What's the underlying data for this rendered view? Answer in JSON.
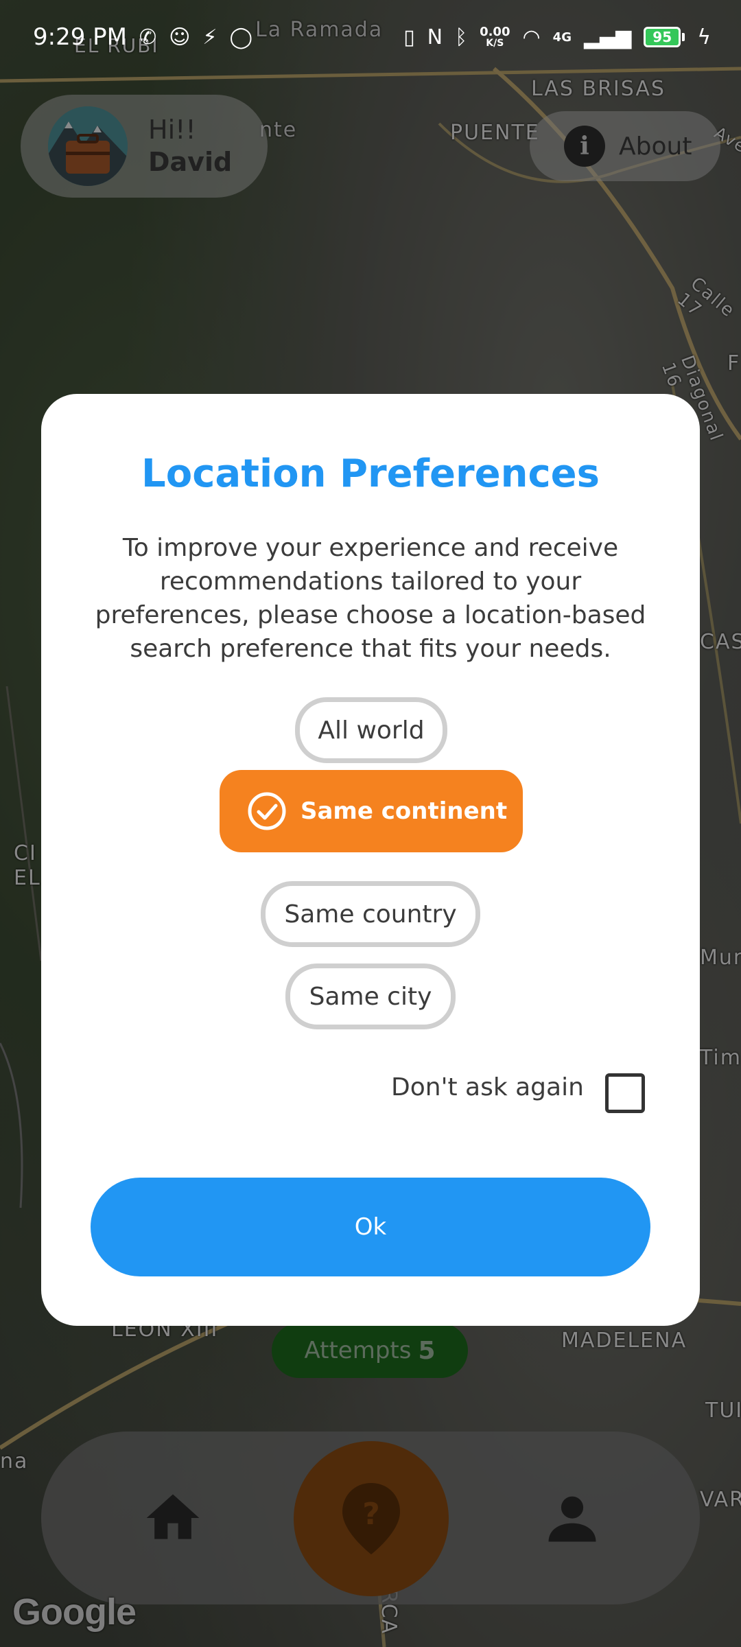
{
  "status_bar": {
    "time": "9:29 PM",
    "speed_value": "0.00",
    "speed_unit": "K/S",
    "network": "4G",
    "battery": "95"
  },
  "map": {
    "labels": [
      "La Ramada",
      "EL RUBI",
      "LAS BRISAS",
      "PUENTE",
      "Calle 17",
      "Diagonal 16",
      "LEON XIII",
      "MADELENA",
      "CAS",
      "Mun",
      "Timi",
      "TUI",
      "VAR",
      "CI",
      "EL",
      "ARCA",
      "nte",
      "na",
      "F",
      "Ave"
    ]
  },
  "header": {
    "greeting": "Hi!!",
    "user_name": "David",
    "about_label": "About"
  },
  "dialog": {
    "title": "Location Preferences",
    "description": "To improve your experience and receive recommendations tailored to your preferences, please choose a location-based search preference that fits your needs.",
    "options": [
      {
        "label": "All world",
        "selected": false
      },
      {
        "label": "Same continent",
        "selected": true
      },
      {
        "label": "Same country",
        "selected": false
      },
      {
        "label": "Same city",
        "selected": false
      }
    ],
    "dont_ask_label": "Don't ask again",
    "dont_ask_checked": false,
    "ok_label": "Ok"
  },
  "attempts": {
    "label": "Attempts",
    "count": "5"
  },
  "bottom_nav": {
    "items": [
      "home-icon",
      "question-pin-icon",
      "profile-icon"
    ]
  },
  "branding": {
    "map_provider": "Google"
  },
  "colors": {
    "title_blue": "#2196f3",
    "selected_orange": "#f5821f",
    "attempts_green": "#1d6a1d",
    "battery_green": "#34c759"
  }
}
